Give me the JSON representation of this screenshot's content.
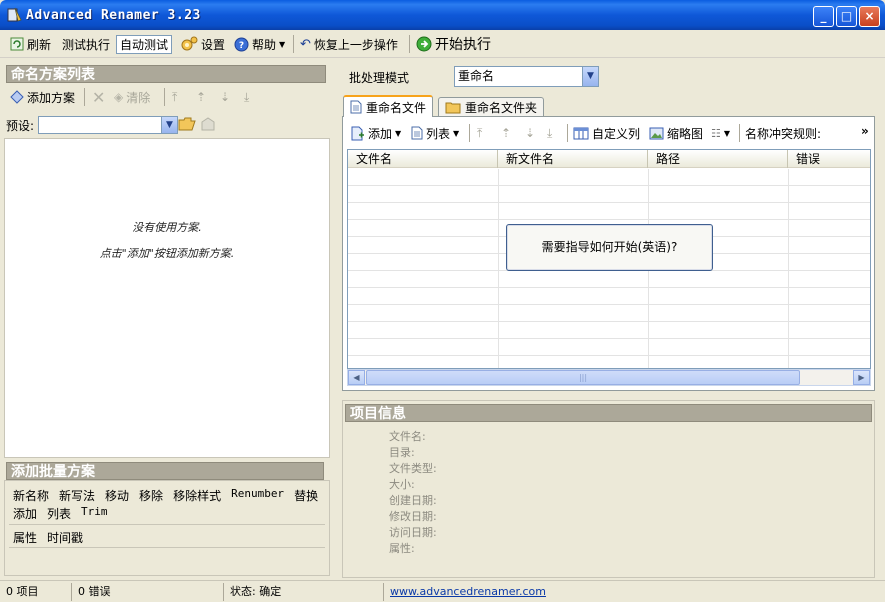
{
  "window": {
    "title": "Advanced Renamer 3.23",
    "min": "_",
    "max": "□",
    "close": "×"
  },
  "toolbar": {
    "refresh": "刷新",
    "test_run": "测试执行",
    "auto_test": "自动测试",
    "settings": "设置",
    "help": "帮助",
    "undo": "恢复上一步操作",
    "start": "开始执行"
  },
  "left": {
    "methods_header": "命名方案列表",
    "add_method": "添加方案",
    "clear": "清除",
    "preset_label": "预设:",
    "empty_line1": "没有使用方案.",
    "empty_line2": "点击\"添加\"按钮添加新方案.",
    "batch_header": "添加批量方案",
    "batch_row1": [
      "新名称",
      "新写法",
      "移动",
      "移除",
      "移除样式",
      "Renumber",
      "替换"
    ],
    "batch_row2": [
      "添加",
      "列表",
      "Trim"
    ],
    "batch_row3": [
      "属性",
      "时间戳"
    ]
  },
  "right": {
    "mode_label": "批处理模式",
    "mode_value": "重命名",
    "tab_files": "重命名文件",
    "tab_folders": "重命名文件夹",
    "add": "添加",
    "list": "列表",
    "custom_columns": "自定义列",
    "thumbnails": "缩略图",
    "conflict_rule": "名称冲突规则:",
    "more": "»",
    "columns": [
      "文件名",
      "新文件名",
      "路径",
      "错误"
    ],
    "help_prompt": "需要指导如何开始(英语)?",
    "info_header": "项目信息",
    "info_fields": [
      "文件名:",
      "目录:",
      "文件类型:",
      "大小:",
      "创建日期:",
      "修改日期:",
      "访问日期:",
      "属性:"
    ]
  },
  "status": {
    "items": "0 项目",
    "errors": "0 错误",
    "state": "状态: 确定",
    "link": "www.advancedrenamer.com"
  },
  "colors": {
    "titlebar": "#0a5de0",
    "panel_header": "#aca899",
    "tab_accent": "#f7a31b",
    "link": "#0b3aa8"
  }
}
